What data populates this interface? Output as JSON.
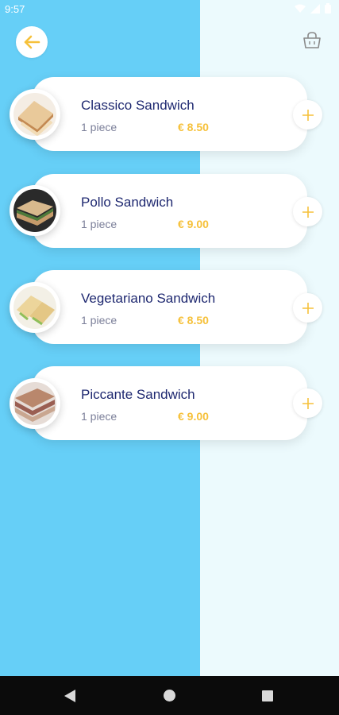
{
  "status_bar": {
    "time": "9:57"
  },
  "colors": {
    "accent": "#f6c13b",
    "title": "#1e2870",
    "panel_left": "#66cff7",
    "panel_right": "#ecfafd"
  },
  "header": {
    "back_icon": "arrow-left-icon",
    "cart_icon": "basket-icon"
  },
  "items": [
    {
      "name": "Classico Sandwich",
      "quantity": "1 piece",
      "price": "€ 8.50"
    },
    {
      "name": "Pollo Sandwich",
      "quantity": "1 piece",
      "price": "€ 9.00"
    },
    {
      "name": "Vegetariano Sandwich",
      "quantity": "1 piece",
      "price": "€ 8.50"
    },
    {
      "name": "Piccante Sandwich",
      "quantity": "1 piece",
      "price": "€ 9.00"
    }
  ]
}
